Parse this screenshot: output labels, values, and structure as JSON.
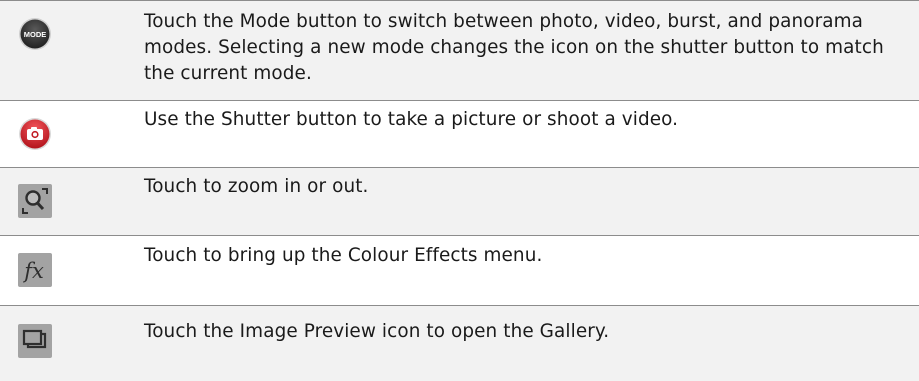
{
  "rows": [
    {
      "icon": "mode-button-icon",
      "icon_text": "MODE",
      "text": "Touch the Mode button to switch between photo, video, burst, and panorama modes. Selecting a new mode changes the icon on the shutter button to match the current mode."
    },
    {
      "icon": "shutter-camera-icon",
      "text": "Use the Shutter button to take a picture or shoot a video."
    },
    {
      "icon": "zoom-icon",
      "text": "Touch to zoom in or out."
    },
    {
      "icon": "fx-icon",
      "text": "Touch to bring up the Colour Effects menu."
    },
    {
      "icon": "image-preview-icon",
      "text": "Touch the Image Preview icon to open the Gallery."
    }
  ],
  "colors": {
    "shaded_row": "#f2f2f2",
    "rule": "#8c8c8c",
    "shutter_red": "#d7262e",
    "icon_gray": "#9a9a9a",
    "mode_dark": "#2b2b2b"
  }
}
